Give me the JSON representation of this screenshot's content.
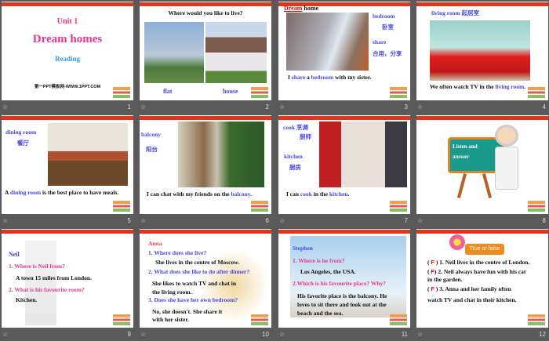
{
  "footer_icon": "star-icon",
  "slides": [
    {
      "num": "1",
      "title": "Unit 1",
      "subtitle": "Dream homes",
      "section": "Reading",
      "watermark": "第一PPT模板网-WWW.1PPT.COM"
    },
    {
      "num": "2",
      "question": "Where would you like to live?",
      "labels": [
        "flat",
        "house"
      ]
    },
    {
      "num": "3",
      "title_a": "Dream",
      "title_b": "home",
      "word1": "bedroom",
      "word1_cn": "卧室",
      "word2": "share",
      "word2_cn": "合用，分享",
      "sentence": [
        "I ",
        "share",
        " a ",
        "bedroom",
        " with my sister."
      ]
    },
    {
      "num": "4",
      "title": "living room  起居室",
      "sentence": [
        "We often watch TV in the ",
        "living room",
        "."
      ]
    },
    {
      "num": "5",
      "word": "dining room",
      "word_cn": "餐厅",
      "sentence": [
        "A ",
        "dining room",
        " is the best place to have meals."
      ]
    },
    {
      "num": "6",
      "word": "balcony",
      "word_cn": "阳台",
      "sentence": [
        "I can chat with my friends on the ",
        "balcony",
        "."
      ]
    },
    {
      "num": "7",
      "word1": "cook 烹调",
      "word1_cn": "厨师",
      "word2": "kitchen",
      "word2_cn": "厨房",
      "sentence": [
        "I can ",
        "cook",
        " in the ",
        "kitchen",
        "."
      ]
    },
    {
      "num": "8",
      "board_line1": "Listen and",
      "board_line2": "answer"
    },
    {
      "num": "9",
      "name": "Neil",
      "q1": "1. Where is Neil from?",
      "a1": "A town 15 miles from London.",
      "q2": "2. What is his favourite room?",
      "a2": "Kitchen."
    },
    {
      "num": "10",
      "name": "Anna",
      "q1": "1. Where does she live?",
      "a1": "She lives in the centre of Moscow.",
      "q2": "2. What does she like to do after dinner?",
      "a2a": "She likes to watch TV and chat in",
      "a2b": "the living room.",
      "q3": "3. Does she have her own bedroom?",
      "a3a": "No, she doesn't. She share it",
      "a3b": "with her sister."
    },
    {
      "num": "11",
      "name": "Stephen",
      "q1": "1. Where is he from?",
      "a1": "Los Angeles, the USA.",
      "q2": "2.Which is his favourite place? Why?",
      "a2a": "His favorite place is the balcony. He",
      "a2b": "loves to sit there and look out at the",
      "a2c": "beach and the sea."
    },
    {
      "num": "12",
      "banner": "True or false",
      "mark": "F",
      "items": [
        "1. Neil lives in the centre of London.",
        "2. Neil always have fun with his cat",
        "in the garden.",
        "3. Anna and her family often",
        "watch TV and chat in their kitchen."
      ]
    }
  ]
}
